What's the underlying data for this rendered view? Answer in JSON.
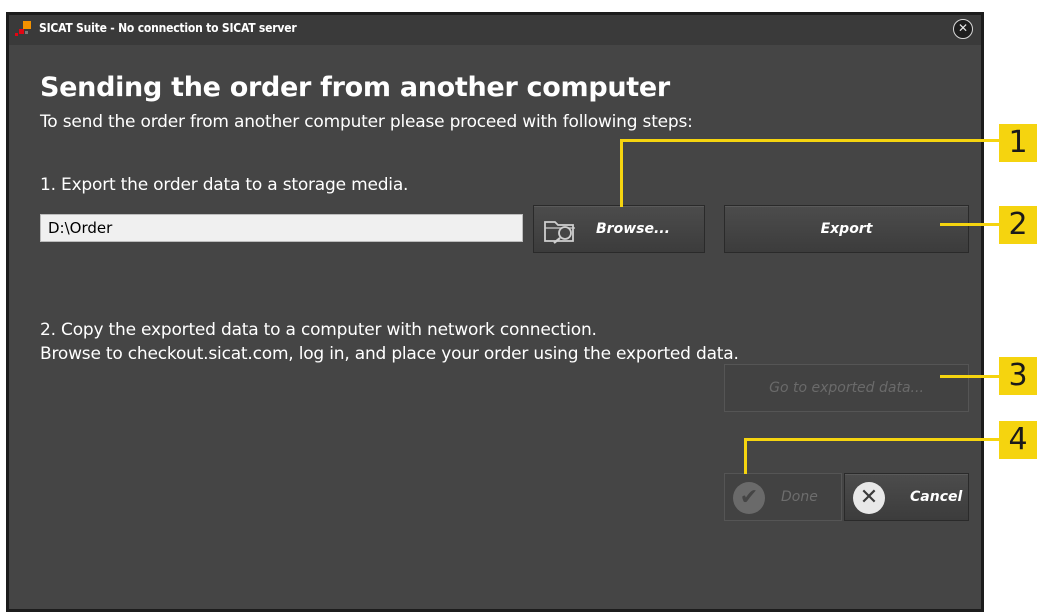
{
  "window": {
    "title": "SICAT Suite - No connection to SICAT server"
  },
  "dialog": {
    "heading": "Sending the order from another computer",
    "intro": "To send the order from another computer please proceed with following steps:",
    "step1": "1. Export the order data to a storage media.",
    "path_value": "D:\\Order",
    "browse_label": "Browse...",
    "export_label": "Export",
    "step2_line1": "2. Copy the exported data to a computer with network connection.",
    "step2_line2": "Browse to checkout.sicat.com, log in, and place your order using the exported data.",
    "goto_label": "Go to exported data...",
    "done_label": "Done",
    "cancel_label": "Cancel"
  },
  "callouts": [
    "1",
    "2",
    "3",
    "4"
  ],
  "icons": {
    "app": "sicat-logo-icon",
    "close": "close-icon",
    "browse": "folder-search-icon",
    "done": "checkmark-icon",
    "cancel": "cancel-x-icon"
  },
  "colors": {
    "accent": "#f5d40f",
    "window_bg": "#454545",
    "logo_orange": "#f39200",
    "logo_red": "#e30613"
  }
}
